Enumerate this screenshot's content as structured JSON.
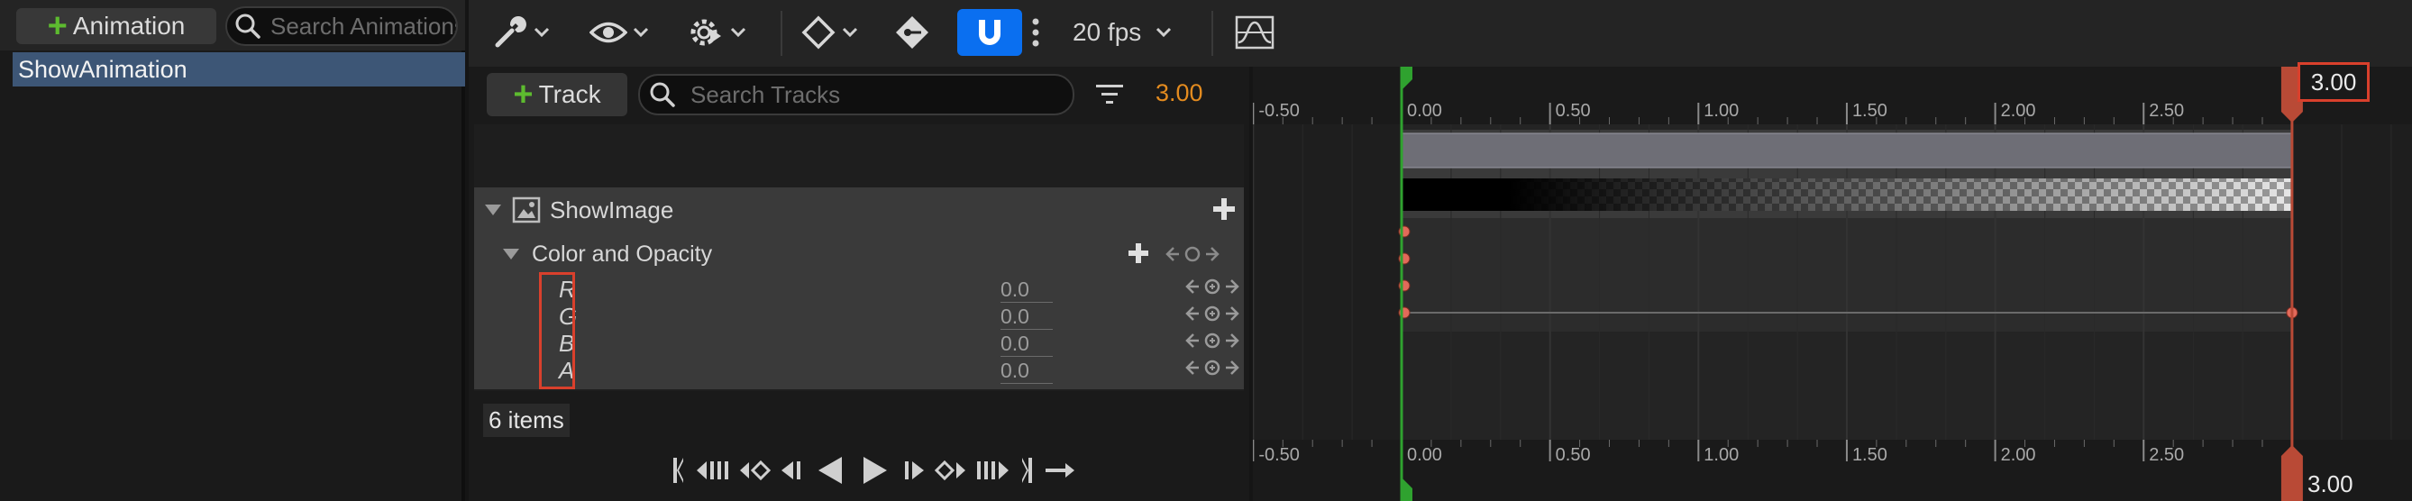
{
  "animations_panel": {
    "add_label": "Animation",
    "search_placeholder": "Search Animations",
    "items": [
      "ShowAnimation"
    ]
  },
  "toolbar": {
    "fps_label": "20 fps",
    "snap_active": true
  },
  "outliner": {
    "add_track_label": "Track",
    "search_placeholder": "Search Tracks",
    "current_time": "3.00",
    "items_count": "6 items",
    "tracks": [
      {
        "label": "ShowImage"
      },
      {
        "label": "Color and Opacity"
      }
    ],
    "channels": [
      {
        "label": "R",
        "value": "0.0"
      },
      {
        "label": "G",
        "value": "0.0"
      },
      {
        "label": "B",
        "value": "0.0"
      },
      {
        "label": "A",
        "value": "0.0"
      }
    ]
  },
  "timeline": {
    "ticks": [
      "-0.50",
      "0.00",
      "0.50",
      "1.00",
      "1.50",
      "2.00",
      "2.50"
    ],
    "start_time": 0.0,
    "end_time": 3.0,
    "end_label_top": "3.00",
    "end_label_bottom": "3.00"
  },
  "colors": {
    "accent_blue": "#0a6ff0",
    "add_green": "#5dbb2f",
    "time_orange": "#e38b1f",
    "highlight_red": "#d9402c",
    "start_marker_green": "#2fa22f",
    "end_marker_red": "#b94a36",
    "selection_blue": "#3d5676"
  }
}
